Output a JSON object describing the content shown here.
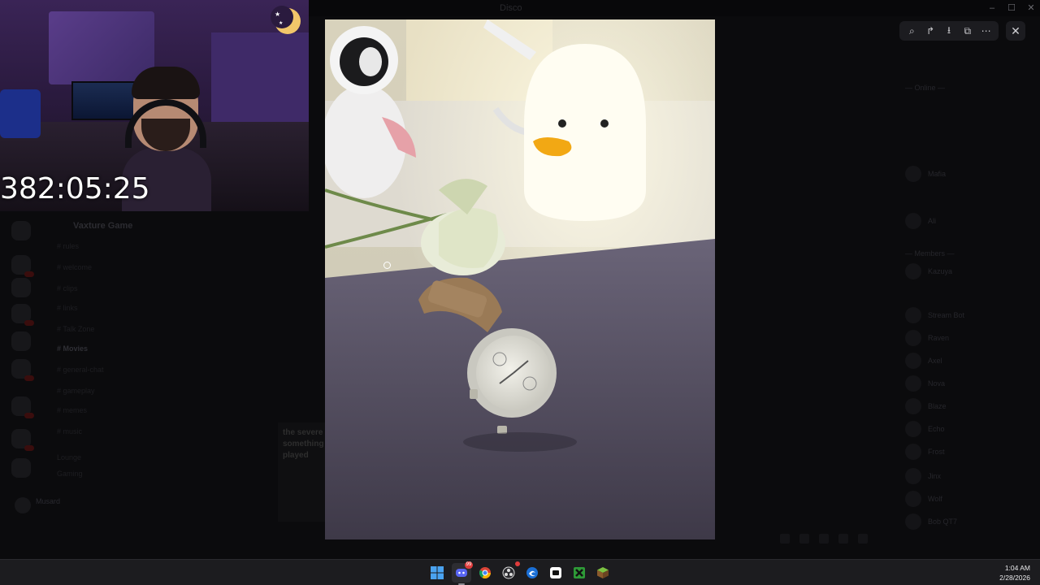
{
  "window": {
    "title": "Disco"
  },
  "background": {
    "guild_name": "Vaxture Game",
    "channels": [
      {
        "label": "# rules",
        "bold": false
      },
      {
        "label": "# welcome",
        "bold": false
      },
      {
        "label": "# clips",
        "bold": false
      },
      {
        "label": "# links",
        "bold": false
      },
      {
        "label": "# Talk Zone",
        "bold": false
      },
      {
        "label": "# Movies",
        "bold": true
      },
      {
        "label": "# general-chat",
        "bold": false
      },
      {
        "label": "# gameplay",
        "bold": false
      },
      {
        "label": "# memes",
        "bold": false
      },
      {
        "label": "# music",
        "bold": false
      },
      {
        "label": "Lounge",
        "bold": false
      },
      {
        "label": "Gaming",
        "bold": false
      }
    ],
    "user_name": "Musard",
    "chat_preview": "the severe something played",
    "members": [
      "— Online —",
      "Mafia",
      "Ali",
      "— Members —",
      "Kazuya",
      "Stream Bot",
      "Raven",
      "Axel",
      "Nova",
      "Blaze",
      "Echo",
      "Frost",
      "Jinx",
      "Wolf",
      "Bob QT7"
    ]
  },
  "webcam": {
    "timer": "382:05:25"
  },
  "viewer": {
    "toolbar": {
      "zoom_icon": "zoom-in-icon",
      "forward_icon": "forward-icon",
      "download_icon": "download-icon",
      "open_icon": "open-external-icon",
      "more_icon": "more-icon",
      "zoom_glyph": "⌕",
      "forward_glyph": "↱",
      "download_glyph": "⭳",
      "open_glyph": "⧉",
      "more_glyph": "⋯"
    },
    "close_glyph": "✕"
  },
  "taskbar": {
    "apps": [
      {
        "name": "windows-start",
        "badge": ""
      },
      {
        "name": "discord",
        "badge": "99"
      },
      {
        "name": "chrome",
        "badge": ""
      },
      {
        "name": "obs",
        "badge": ""
      },
      {
        "name": "edge",
        "badge": ""
      },
      {
        "name": "capcut",
        "badge": ""
      },
      {
        "name": "xbox",
        "badge": ""
      },
      {
        "name": "minecraft",
        "badge": ""
      }
    ],
    "time": "1:04 AM",
    "date": "2/28/2026"
  },
  "colors": {
    "taskbar": "#1c1c1f",
    "badge": "#e03c3c",
    "webcam_bg": "#3a2456"
  }
}
